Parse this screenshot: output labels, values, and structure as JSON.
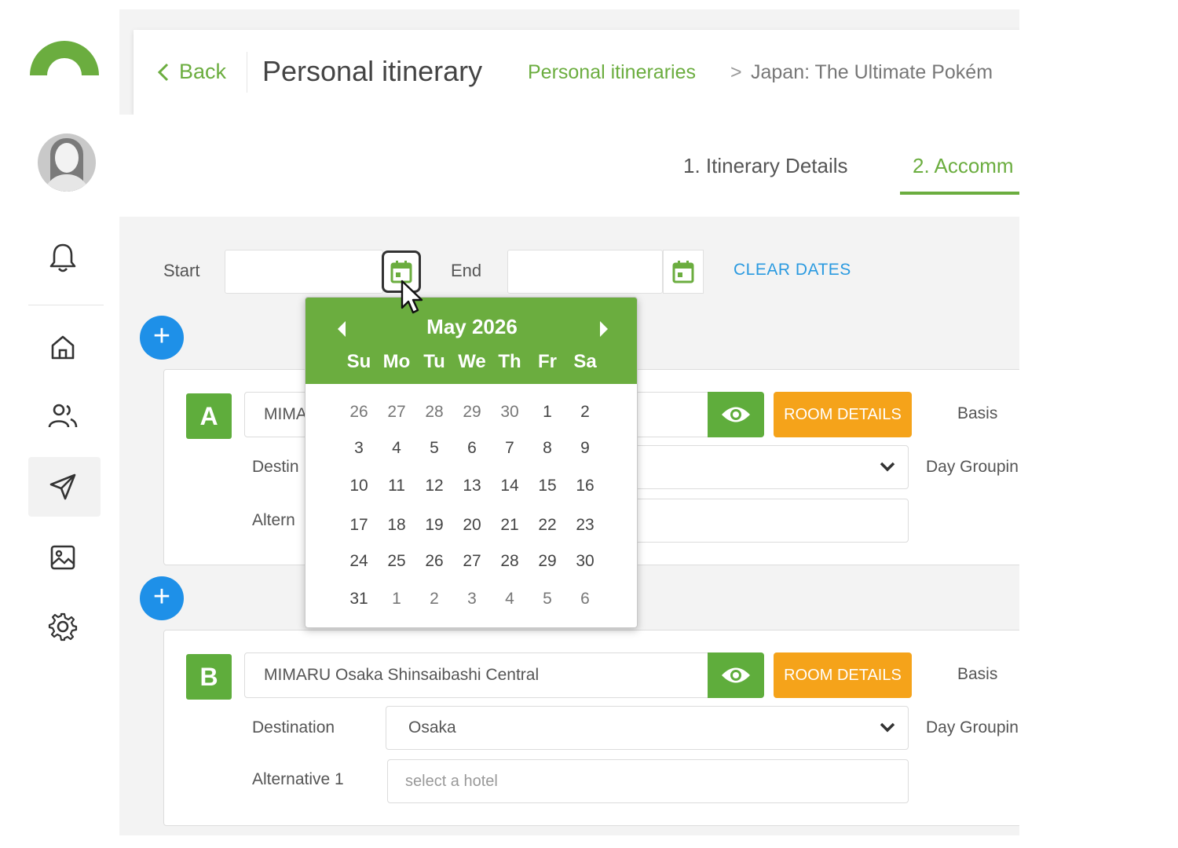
{
  "colors": {
    "brand_green": "#6bad3f",
    "plus_blue": "#1e90e8",
    "room_orange": "#f5a31a",
    "link_blue": "#2a9ae0"
  },
  "sidebar": {
    "icons": [
      "logo-arc",
      "user-avatar",
      "bell-icon",
      "home-icon",
      "people-icon",
      "send-icon",
      "image-icon",
      "gear-icon"
    ],
    "active_item": "send-icon"
  },
  "header": {
    "back_label": "Back",
    "title": "Personal itinerary",
    "breadcrumb_1": "Personal itineraries",
    "breadcrumb_sep": ">",
    "breadcrumb_2": "Japan: The Ultimate Pokém"
  },
  "tabs": [
    {
      "label": "1. Itinerary Details"
    },
    {
      "label": "2. Accomm"
    }
  ],
  "dates": {
    "start_label": "Start",
    "start_value": "",
    "end_label": "End",
    "end_value": "",
    "clear_label": "CLEAR DATES"
  },
  "datepicker": {
    "month_label": "May 2026",
    "dow": [
      "Su",
      "Mo",
      "Tu",
      "We",
      "Th",
      "Fr",
      "Sa"
    ],
    "weeks": [
      [
        "26",
        "27",
        "28",
        "29",
        "30",
        "1",
        "2"
      ],
      [
        "3",
        "4",
        "5",
        "6",
        "7",
        "8",
        "9"
      ],
      [
        "10",
        "11",
        "12",
        "13",
        "14",
        "15",
        "16"
      ],
      [
        "17",
        "18",
        "19",
        "20",
        "21",
        "22",
        "23"
      ],
      [
        "24",
        "25",
        "26",
        "27",
        "28",
        "29",
        "30"
      ],
      [
        "31",
        "1",
        "2",
        "3",
        "4",
        "5",
        "6"
      ]
    ]
  },
  "cards": [
    {
      "letter": "A",
      "hotel": "MIMA",
      "room_details_label": "ROOM DETAILS",
      "basis_label": "Basis",
      "destination_label": "Destin",
      "destination_value": "",
      "alternative_label": "Altern",
      "alternative_placeholder": "",
      "day_grouping_label": "Day Groupin"
    },
    {
      "letter": "B",
      "hotel": "MIMARU Osaka Shinsaibashi Central",
      "room_details_label": "ROOM DETAILS",
      "basis_label": "Basis",
      "destination_label": "Destination",
      "destination_value": "Osaka",
      "alternative_label": "Alternative 1",
      "alternative_placeholder": "select a hotel",
      "day_grouping_label": "Day Groupin"
    }
  ]
}
